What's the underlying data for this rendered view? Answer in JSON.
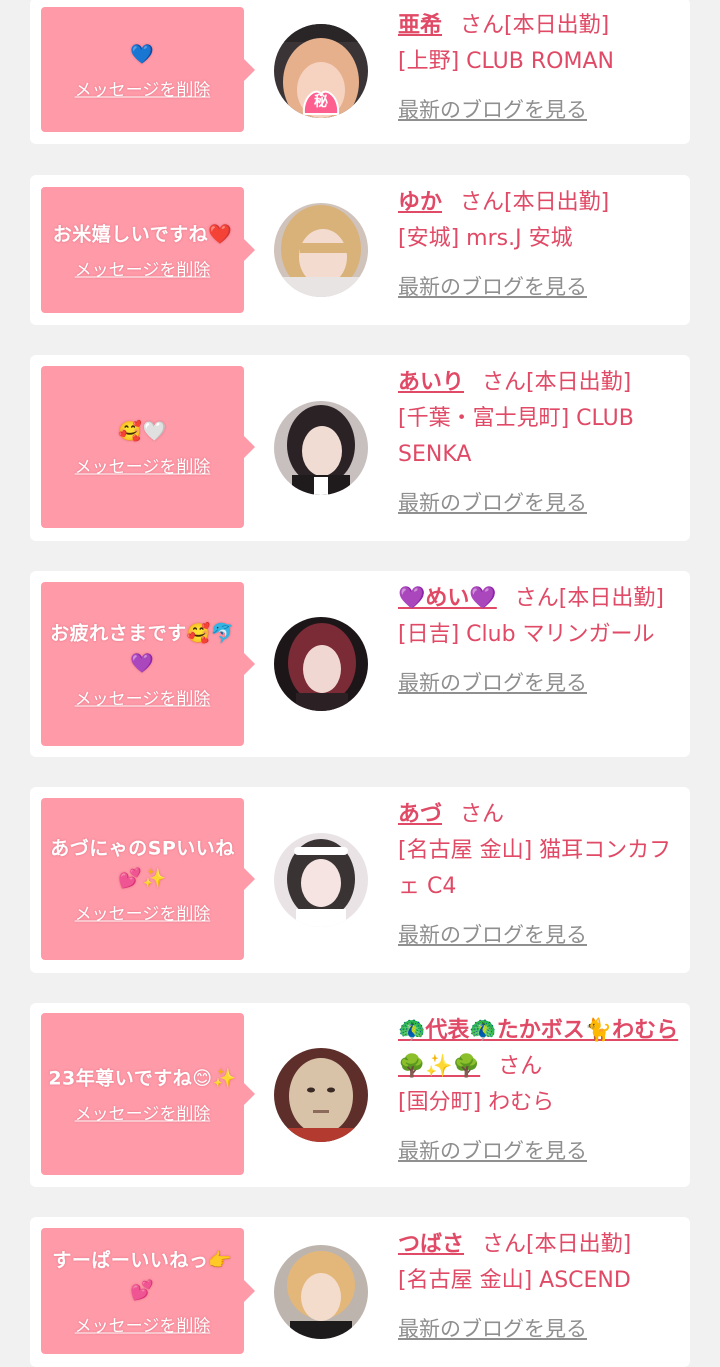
{
  "colors": {
    "page_bg": "#f1f1f1",
    "card_bg": "#ffffff",
    "bubble": "#ff9aa8",
    "accent": "#e04a66",
    "link_gray": "#8f8f8f"
  },
  "delete_label": "メッセージを削除",
  "blog_label": "最新のブログを見る",
  "cards": [
    {
      "message": "💙",
      "name": "亜希",
      "suffix": "さん[本日出勤]",
      "shop": "[上野] CLUB ROMAN",
      "avatar_icon": "avatar-blonde-heart-sticker",
      "avatar_sticker": "秘"
    },
    {
      "message": "お米嬉しいですね❤️",
      "name": "ゆか",
      "suffix": "さん[本日出勤]",
      "shop": "[安城] mrs.J 安城",
      "avatar_icon": "avatar-blonde-woman"
    },
    {
      "message": "🥰🤍",
      "name": "あいり",
      "suffix": "さん[本日出勤]",
      "shop": "[千葉・富士見町] CLUB SENKA",
      "avatar_icon": "avatar-dark-hair-woman"
    },
    {
      "message": "お疲れさまです🥰🐬💜",
      "name": "💜めい💜",
      "suffix": "さん[本日出勤]",
      "shop": "[日吉] Club マリンガール",
      "avatar_icon": "avatar-red-hair-woman"
    },
    {
      "message": "あづにゃのSPいいね💕✨",
      "name": "あづ",
      "suffix": "さん",
      "shop": "[名古屋 金山] 猫耳コンカフェ C4",
      "avatar_icon": "avatar-maid-woman"
    },
    {
      "message": "23年尊いですね😊✨",
      "name": "🦚代表🦚たかボス🐈わむら🌳✨🌳",
      "suffix": "さん",
      "shop": "[国分町] わむら",
      "avatar_icon": "avatar-cartoon-face"
    },
    {
      "message": "すーぱーいいねっ👉💕",
      "name": "つばさ",
      "suffix": "さん[本日出勤]",
      "shop": "[名古屋 金山] ASCEND",
      "avatar_icon": "avatar-blonde-man"
    }
  ]
}
